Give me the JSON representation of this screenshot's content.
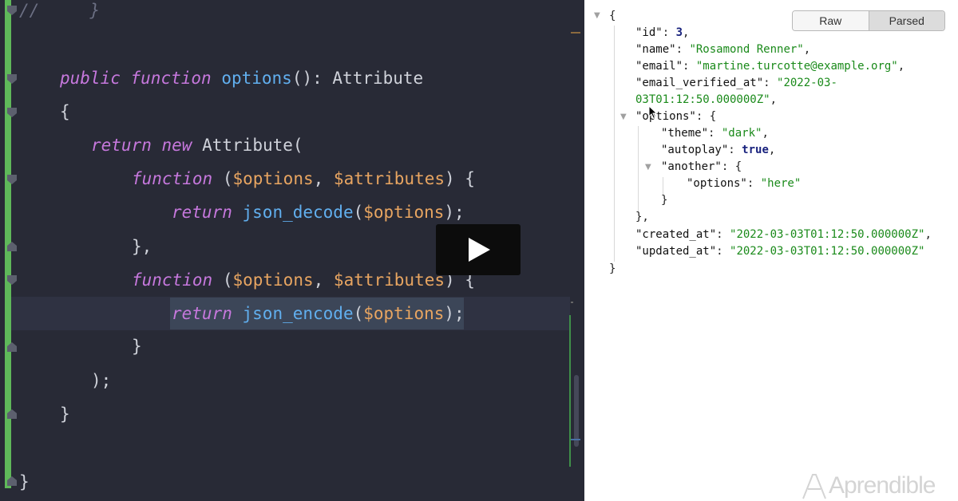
{
  "editor": {
    "lines": {
      "l1_comment": "//",
      "l1_brace": "}",
      "l3_public": "public",
      "l3_function": "function",
      "l3_name": "options",
      "l3_rest": "(): Attribute",
      "l4": "{",
      "l5_return": "return",
      "l5_new": "new",
      "l5_rest": "Attribute(",
      "l6_function": "function",
      "l6_open": "(",
      "l6_var1": "$options",
      "l6_comma": ", ",
      "l6_var2": "$attributes",
      "l6_close": ") {",
      "l7_return": "return",
      "l7_fn": "json_decode",
      "l7_open": "(",
      "l7_var": "$options",
      "l7_close": ");",
      "l8": "},",
      "l9_function": "function",
      "l9_open": "(",
      "l9_var1": "$options",
      "l9_comma": ", ",
      "l9_var2": "$attributes",
      "l9_close": ") {",
      "l10_return": "return",
      "l10_fn": "json_encode",
      "l10_open": "(",
      "l10_var": "$options",
      "l10_close": ");",
      "l11": "}",
      "l12": ");",
      "l13": "}",
      "l15": "}"
    }
  },
  "viewer": {
    "raw_label": "Raw",
    "parsed_label": "Parsed",
    "json": {
      "open": "{",
      "id_key": "\"id\"",
      "id_val": "3",
      "name_key": "\"name\"",
      "name_val": "\"Rosamond Renner\"",
      "email_key": "\"email\"",
      "email_val": "\"martine.turcotte@example.org\"",
      "verified_key": "\"email_verified_at\"",
      "verified_val_1": "\"2022-03-",
      "verified_val_2": "03T01:12:50.000000Z\"",
      "options_key": "\"options\"",
      "theme_key": "\"theme\"",
      "theme_val": "\"dark\"",
      "autoplay_key": "\"autoplay\"",
      "autoplay_val": "true",
      "another_key": "\"another\"",
      "inner_options_key": "\"options\"",
      "inner_options_val": "\"here\"",
      "created_key": "\"created_at\"",
      "created_val": "\"2022-03-03T01:12:50.000000Z\"",
      "updated_key": "\"updated_at\"",
      "updated_val": "\"2022-03-03T01:12:50.000000Z\"",
      "close": "}"
    },
    "brand": "Aprendible"
  },
  "colors": {
    "editor_bg": "#282a36",
    "keyword": "#c678dd",
    "function_name": "#61afef",
    "variable": "#e8a561",
    "json_string": "#1a8a1a",
    "json_number": "#1a237e",
    "git_gutter": "#5fb85a"
  },
  "icons": {
    "play": "play-icon",
    "fold": "fold-marker-icon",
    "collapse": "triangle-down-icon",
    "cursor": "mouse-pointer-icon",
    "brand": "aprendible-logo"
  }
}
